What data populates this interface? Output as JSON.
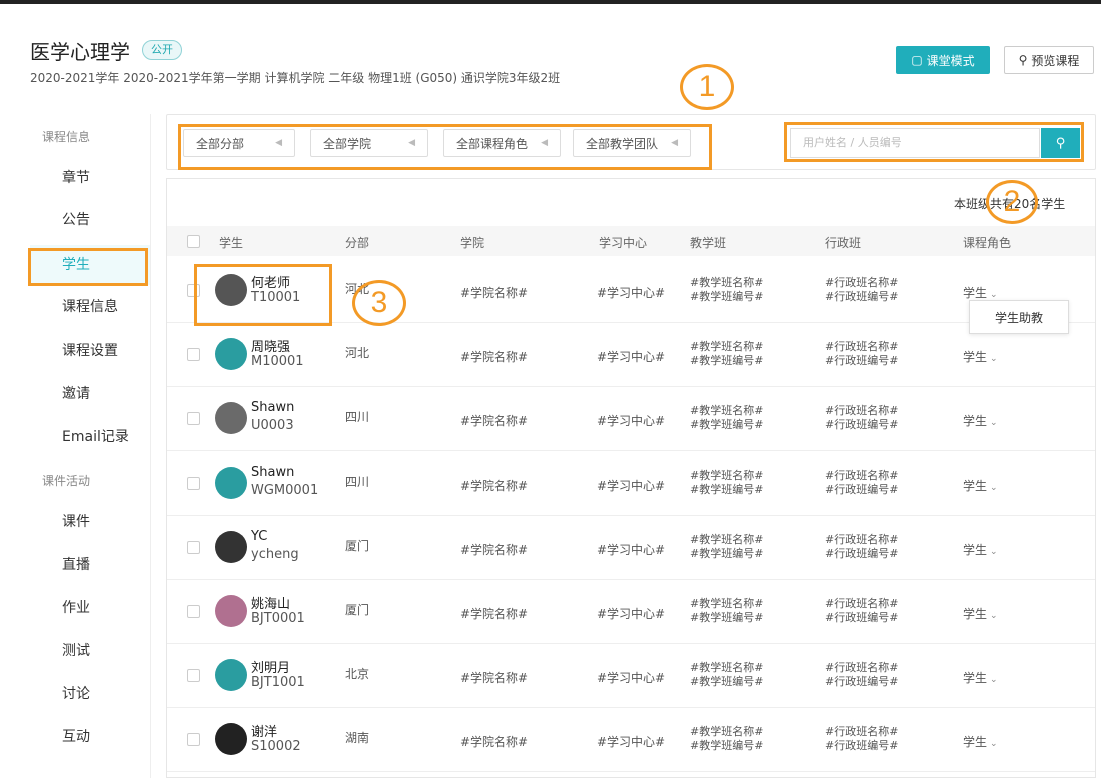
{
  "header": {
    "course_title": "医学心理学",
    "public_badge": "公开",
    "subtitle": "2020-2021学年 2020-2021学年第一学期 计算机学院 二年级 物理1班 (G050) 通识学院3年级2班",
    "class_mode_label": "课堂模式",
    "preview_label": "预览课程"
  },
  "sidebar": {
    "section1": "课程信息",
    "items1": [
      {
        "label": "章节"
      },
      {
        "label": "公告"
      },
      {
        "label": "学生"
      },
      {
        "label": "课程信息"
      },
      {
        "label": "课程设置"
      },
      {
        "label": "邀请"
      },
      {
        "label": "Email记录"
      }
    ],
    "section2": "课件活动",
    "items2": [
      {
        "label": "课件"
      },
      {
        "label": "直播"
      },
      {
        "label": "作业"
      },
      {
        "label": "测试"
      },
      {
        "label": "讨论"
      },
      {
        "label": "互动"
      }
    ],
    "active": "学生"
  },
  "filters": {
    "items": [
      "全部分部",
      "全部学院",
      "全部课程角色",
      "全部教学团队"
    ],
    "search_placeholder": "用户姓名 / 人员编号"
  },
  "annotations": [
    "1",
    "2",
    "3"
  ],
  "table": {
    "count_text": "本班级共有20名学生",
    "headers": [
      "学生",
      "分部",
      "学院",
      "学习中心",
      "教学班",
      "行政班",
      "课程角色"
    ],
    "role_dropdown_option": "学生助教",
    "rows": [
      {
        "name": "何老师",
        "id": "T10001",
        "branch": "河北",
        "college": "#学院名称#",
        "center": "#学习中心#",
        "tclass1": "#教学班名称#",
        "tclass2": "#教学班编号#",
        "aclass1": "#行政班名称#",
        "aclass2": "#行政班编号#",
        "role": "学生"
      },
      {
        "name": "周晓强",
        "id": "M10001",
        "branch": "河北",
        "college": "#学院名称#",
        "center": "#学习中心#",
        "tclass1": "#教学班名称#",
        "tclass2": "#教学班编号#",
        "aclass1": "#行政班名称#",
        "aclass2": "#行政班编号#",
        "role": "学生"
      },
      {
        "name": "Shawn",
        "id": "U0003",
        "branch": "四川",
        "college": "#学院名称#",
        "center": "#学习中心#",
        "tclass1": "#教学班名称#",
        "tclass2": "#教学班编号#",
        "aclass1": "#行政班名称#",
        "aclass2": "#行政班编号#",
        "role": "学生"
      },
      {
        "name": "Shawn",
        "id": "WGM0001",
        "branch": "四川",
        "college": "#学院名称#",
        "center": "#学习中心#",
        "tclass1": "#教学班名称#",
        "tclass2": "#教学班编号#",
        "aclass1": "#行政班名称#",
        "aclass2": "#行政班编号#",
        "role": "学生"
      },
      {
        "name": "YC",
        "id": "ycheng",
        "branch": "厦门",
        "college": "#学院名称#",
        "center": "#学习中心#",
        "tclass1": "#教学班名称#",
        "tclass2": "#教学班编号#",
        "aclass1": "#行政班名称#",
        "aclass2": "#行政班编号#",
        "role": "学生"
      },
      {
        "name": "姚海山",
        "id": "BJT0001",
        "branch": "厦门",
        "college": "#学院名称#",
        "center": "#学习中心#",
        "tclass1": "#教学班名称#",
        "tclass2": "#教学班编号#",
        "aclass1": "#行政班名称#",
        "aclass2": "#行政班编号#",
        "role": "学生"
      },
      {
        "name": "刘明月",
        "id": "BJT1001",
        "branch": "北京",
        "college": "#学院名称#",
        "center": "#学习中心#",
        "tclass1": "#教学班名称#",
        "tclass2": "#教学班编号#",
        "aclass1": "#行政班名称#",
        "aclass2": "#行政班编号#",
        "role": "学生"
      },
      {
        "name": "谢洋",
        "id": "S10002",
        "branch": "湖南",
        "college": "#学院名称#",
        "center": "#学习中心#",
        "tclass1": "#教学班名称#",
        "tclass2": "#教学班编号#",
        "aclass1": "#行政班名称#",
        "aclass2": "#行政班编号#",
        "role": "学生"
      }
    ]
  },
  "colors": {
    "accent": "#20aebb",
    "highlight": "#f39a26"
  }
}
